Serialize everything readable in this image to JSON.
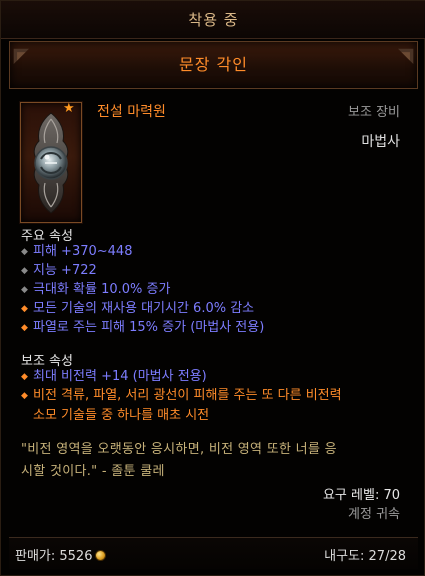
{
  "header": {
    "equipped": "착용 중"
  },
  "item": {
    "name": "문장 각인",
    "rarity": "전설 마력원",
    "slot": "보조 장비",
    "class": "마법사",
    "icon": "legendary-source-orb-icon"
  },
  "primary": {
    "title": "주요 속성",
    "attrs": [
      {
        "text": "피해 +370~448",
        "bullet": "gray",
        "color": "blue"
      },
      {
        "text": "지능 +722",
        "bullet": "gray",
        "color": "blue"
      },
      {
        "text": "극대화 확률 10.0% 증가",
        "bullet": "gray",
        "color": "blue"
      },
      {
        "text": "모든 기술의 재사용 대기시간 6.0% 감소",
        "bullet": "orange",
        "color": "blue"
      },
      {
        "text": "파열로 주는 피해 15% 증가 (마법사 전용)",
        "bullet": "orange",
        "color": "blue"
      }
    ]
  },
  "secondary": {
    "title": "보조 속성",
    "attr1": "최대 비전력 +14 (마법사 전용)",
    "attr2_line1": "비전 격류, 파열, 서리 광선이 피해를 주는 또 다른 비전력",
    "attr2_line2": "소모 기술들 중 하나를 매초 시전"
  },
  "flavor": {
    "line1": "\"비전 영역을 오랫동안 응시하면, 비전 영역 또한 너를 응",
    "line2": "시할 것이다.\" - 졸툰 쿨레"
  },
  "requirements": {
    "level": "요구 레벨: 70",
    "bound": "계정 귀속"
  },
  "footer": {
    "sell_price": "판매가: 5526",
    "durability": "내구도: 27/28"
  },
  "colors": {
    "legendary": "#ff8c2a",
    "magic": "#7d7dff",
    "flavor": "#c7b27a"
  }
}
